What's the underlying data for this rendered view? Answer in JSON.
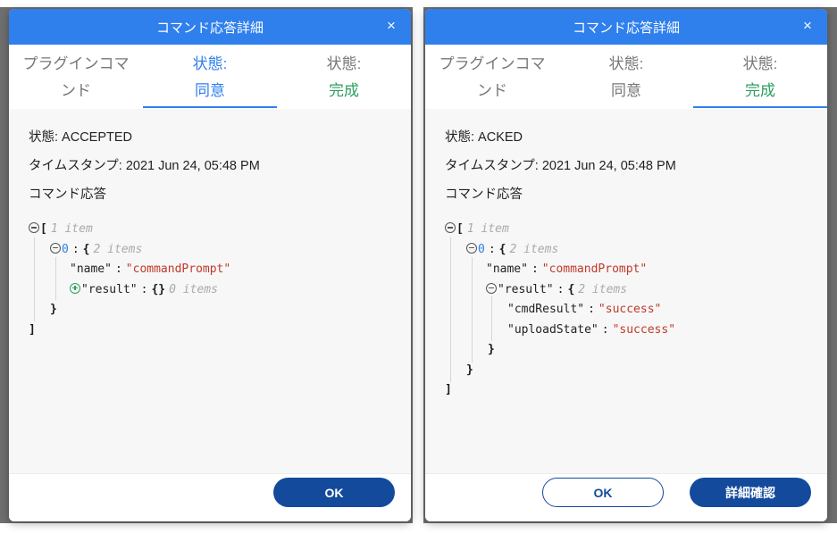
{
  "dialogs": [
    {
      "title": "コマンド応答詳細",
      "close_icon": "×",
      "tabs": [
        {
          "line1": "プラグインコマ",
          "line2": "ンド"
        },
        {
          "line1": "状態:",
          "line2": "同意"
        },
        {
          "line1": "状態:",
          "line2": "完成"
        }
      ],
      "status_line": "状態: ACCEPTED",
      "timestamp_line": "タイムスタンプ: 2021 Jun 24, 05:48 PM",
      "response_label": "コマンド応答",
      "json": {
        "open_bracket": "[",
        "array_count": "1 item",
        "index": "0",
        "colon": ":",
        "open_brace": "{",
        "object_count": "2 items",
        "name_key": "\"name\"",
        "name_value": "\"commandPrompt\"",
        "result_key": "\"result\"",
        "result_value": "{}",
        "result_count": "0 items",
        "close_brace": "}",
        "close_bracket": "]"
      },
      "ok_label": "OK"
    },
    {
      "title": "コマンド応答詳細",
      "close_icon": "×",
      "tabs": [
        {
          "line1": "プラグインコマ",
          "line2": "ンド"
        },
        {
          "line1": "状態:",
          "line2": "同意"
        },
        {
          "line1": "状態:",
          "line2": "完成"
        }
      ],
      "status_line": "状態: ACKED",
      "timestamp_line": "タイムスタンプ: 2021 Jun 24, 05:48 PM",
      "response_label": "コマンド応答",
      "json": {
        "open_bracket": "[",
        "array_count": "1 item",
        "index": "0",
        "colon": ":",
        "open_brace": "{",
        "object_count": "2 items",
        "name_key": "\"name\"",
        "name_value": "\"commandPrompt\"",
        "result_key": "\"result\"",
        "result_count": "2 items",
        "cmd_key": "\"cmdResult\"",
        "cmd_value": "\"success\"",
        "upload_key": "\"uploadState\"",
        "upload_value": "\"success\"",
        "close_brace": "}",
        "close_bracket": "]"
      },
      "ok_label": "OK",
      "details_label": "詳細確認"
    }
  ],
  "colors": {
    "header_blue": "#2f80ed",
    "button_navy": "#134a9c",
    "tab_completed_green": "#2e9e5e",
    "json_string_red": "#c0392b"
  }
}
